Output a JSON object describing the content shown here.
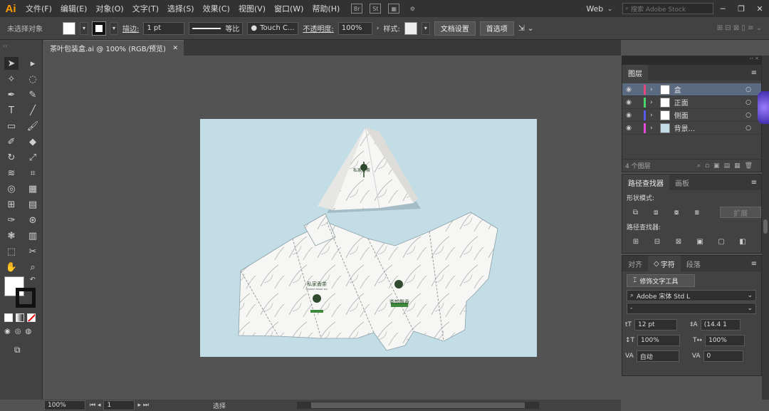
{
  "app": {
    "logo": "Ai"
  },
  "menu": [
    "文件(F)",
    "编辑(E)",
    "对象(O)",
    "文字(T)",
    "选择(S)",
    "效果(C)",
    "视图(V)",
    "窗口(W)",
    "帮助(H)"
  ],
  "menubar_right": {
    "workspace": "Web",
    "search_placeholder": "搜索 Adobe Stock"
  },
  "control": {
    "selection_status": "未选择对象",
    "stroke_label": "描边:",
    "stroke_value": "1 pt",
    "line_style": "等比",
    "brush": "Touch C...",
    "opacity_label": "不透明度:",
    "opacity_value": "100%",
    "style_label": "样式:",
    "doc_setup": "文档设置",
    "preferences": "首选项"
  },
  "document": {
    "tab_title": "茶叶包装盒.ai @ 100% (RGB/预览)",
    "close": "✕"
  },
  "status": {
    "zoom": "100%",
    "artboard": "1",
    "tool": "选择"
  },
  "layers": {
    "tab": "图层",
    "items": [
      {
        "name": "盒",
        "color": "#e8467a",
        "selected": true
      },
      {
        "name": "正面",
        "color": "#4cd36a",
        "selected": false
      },
      {
        "name": "侧面",
        "color": "#5a5ae8",
        "selected": false
      },
      {
        "name": "背景...",
        "color": "#e84ad8",
        "selected": false
      }
    ],
    "count": "4 个图层"
  },
  "pathfinder": {
    "tab_active": "路径查找器",
    "tab_other": "画板",
    "shape_modes": "形状模式:",
    "expand": "扩展",
    "pathfinders": "路径查找器:"
  },
  "character": {
    "tab_align": "对齐",
    "tab_char": "字符",
    "tab_para": "段落",
    "touch_type": "修饰文字工具",
    "font_family": "Adobe 宋体 Std L",
    "font_style": "-",
    "size": "12 pt",
    "leading": "(14.4 1",
    "vscale": "100%",
    "hscale": "100%",
    "kerning": "自动",
    "tracking": "0"
  },
  "box_text": {
    "brand": "私家香茶",
    "sub": "CHINESE HERBS TEA",
    "front_brand": "茶韵飘香"
  },
  "colors": {
    "artboard": "#c3dde6",
    "ui_dark": "#323232",
    "ui_mid": "#424242",
    "canvas": "#535353",
    "accent_logo": "#ff9a00"
  }
}
